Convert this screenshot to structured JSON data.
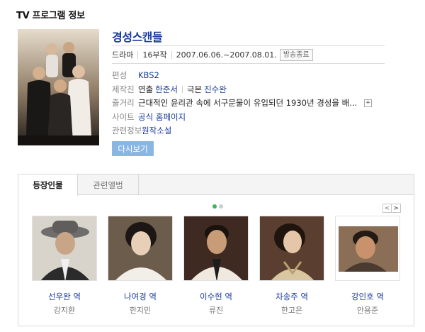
{
  "section": {
    "title": "TV 프로그램 정보"
  },
  "program": {
    "title": "경성스캔들",
    "genre": "드라마",
    "episodes": "16부작",
    "dates": "2007.06.06.~2007.08.01.",
    "status_badge": "방송종료"
  },
  "info": {
    "network_label": "편성",
    "network_value": "KBS2",
    "staff_label": "제작진",
    "director_label": "연출",
    "director_name": "한준서",
    "writer_label": "극본",
    "writer_name": "진수완",
    "plot_label": "줄거리",
    "plot_text": "근대적인 윤리관 속에 서구문물이 유입되던 1930년 경성을 배...",
    "site_label": "사이트",
    "site_value": "공식 홈페이지",
    "related_label": "관련정보",
    "related_value": "원작소설"
  },
  "replay_label": "다시보기",
  "tabs": [
    {
      "label": "등장인물"
    },
    {
      "label": "관련앨범"
    }
  ],
  "pager": {
    "prev": "<",
    "next": ">"
  },
  "colors": {
    "title_link": "#1a3c9c",
    "replay_button": "#8ab6e4",
    "dot_active": "#3db55a",
    "dot_inactive": "#cccccc"
  },
  "cast": [
    {
      "role": "선우완 역",
      "actor": "강지환"
    },
    {
      "role": "나여경 역",
      "actor": "한지민"
    },
    {
      "role": "이수현 역",
      "actor": "류진"
    },
    {
      "role": "차송주 역",
      "actor": "한고은"
    },
    {
      "role": "강인호 역",
      "actor": "안용준"
    }
  ]
}
